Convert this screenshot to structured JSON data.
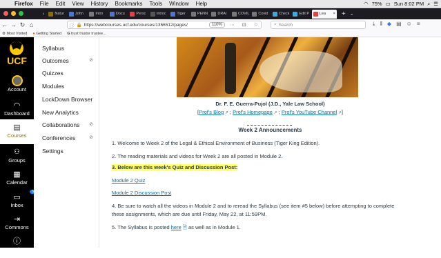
{
  "mac_menu": {
    "app": "Firefox",
    "items": [
      "File",
      "Edit",
      "View",
      "History",
      "Bookmarks",
      "Tools",
      "Window",
      "Help"
    ],
    "battery": "75%",
    "clock": "Sun 8:02 PM"
  },
  "browser": {
    "tabs": [
      {
        "label": "Natur",
        "color": "#8a6d00"
      },
      {
        "label": "John",
        "color": "#4a76d4"
      },
      {
        "label": "Intro",
        "color": "#7a7a7a"
      },
      {
        "label": "Docu",
        "color": "#4a76d4"
      },
      {
        "label": "Persc",
        "color": "#d44"
      },
      {
        "label": "Introc",
        "color": "#555"
      },
      {
        "label": "Tiger",
        "color": "#4a76d4"
      },
      {
        "label": "PENN",
        "color": "#777"
      },
      {
        "label": "DRAI",
        "color": "#777"
      },
      {
        "label": "COVIL",
        "color": "#777"
      },
      {
        "label": "Covid",
        "color": "#777"
      },
      {
        "label": "Check",
        "color": "#3fa8e0"
      },
      {
        "label": "Edit P",
        "color": "#3fa8e0"
      },
      {
        "label": "Lea",
        "color": "#d44",
        "active": true
      }
    ],
    "url": "https://webcourses.ucf.edu/courses/1356512/pages/",
    "zoom": "110%",
    "search_placeholder": "Search",
    "bookmarks": [
      "Most Visited",
      "Getting Started",
      "trust trustor trustee..."
    ]
  },
  "global_nav": {
    "logo_text": "UCF",
    "items": [
      {
        "label": "Account",
        "icon": "avatar-icon"
      },
      {
        "label": "Dashboard",
        "icon": "dashboard-icon"
      },
      {
        "label": "Courses",
        "icon": "courses-icon",
        "active": true
      },
      {
        "label": "Groups",
        "icon": "groups-icon"
      },
      {
        "label": "Calendar",
        "icon": "calendar-icon"
      },
      {
        "label": "Inbox",
        "icon": "inbox-icon",
        "badge": "552"
      },
      {
        "label": "Commons",
        "icon": "commons-icon"
      },
      {
        "label": "Help",
        "icon": "help-icon"
      }
    ]
  },
  "course_nav": {
    "items": [
      {
        "label": "Syllabus",
        "hidden": false
      },
      {
        "label": "Outcomes",
        "hidden": true
      },
      {
        "label": "Quizzes",
        "hidden": false
      },
      {
        "label": "Modules",
        "hidden": false
      },
      {
        "label": "LockDown Browser",
        "hidden": false
      },
      {
        "label": "New Analytics",
        "hidden": false
      },
      {
        "label": "Collaborations",
        "hidden": true
      },
      {
        "label": "Conferences",
        "hidden": true
      },
      {
        "label": "Settings",
        "hidden": false
      }
    ]
  },
  "page": {
    "author": "Dr. F. E. Guerra-Pujol (J.D., Yale Law School)",
    "links": {
      "open": "[",
      "blog": "Prof's Blog",
      "sep": ";",
      "homepage": "Prof's Homepage",
      "youtube": "Prof's YouTube Channel",
      "close": "]"
    },
    "announcements_heading": "Week 2 Announcements",
    "p1": "1. Welcome to Week 2 of the Legal & Ethical Environment of Business (Tiger King Edition).",
    "p2": "2. The reading materials and videos for Week 2 are all posted in Module 2.",
    "p3": "3. Below are this week's Quiz and Discussion Post:",
    "quiz_link": "Module 2 Quiz",
    "discussion_link": "Module 2 Discussion Post",
    "p4_line1": "4. Be sure to watch all the videos in Module 2 and to reread the Syllabus (see item #5 below) before attempting to complete",
    "p4_line2": "these assignments, which are due until Friday, May 22, at 11:59PM.",
    "p5_pre": "5. The Syllabus is posted",
    "p5_link": "here",
    "p5_post": "as well as in Module 1."
  }
}
